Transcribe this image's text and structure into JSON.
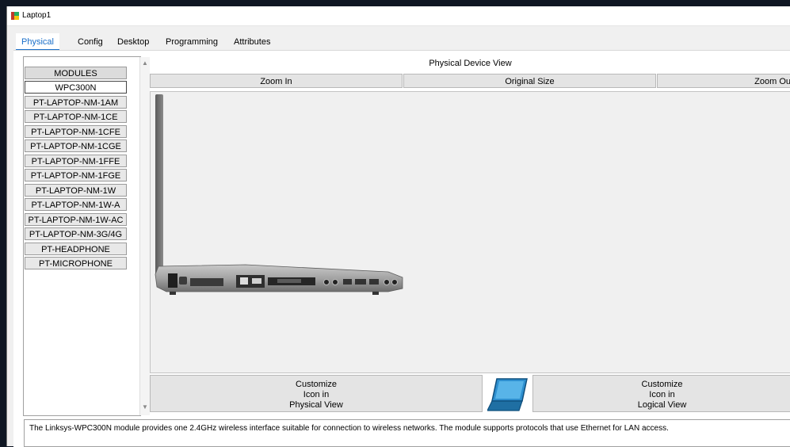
{
  "window": {
    "title": "Laptop1"
  },
  "tabs": [
    {
      "label": "Physical",
      "active": true
    },
    {
      "label": "Config"
    },
    {
      "label": "Desktop"
    },
    {
      "label": "Programming"
    },
    {
      "label": "Attributes"
    }
  ],
  "modules": {
    "header": "MODULES",
    "items": [
      "WPC300N",
      "PT-LAPTOP-NM-1AM",
      "PT-LAPTOP-NM-1CE",
      "PT-LAPTOP-NM-1CFE",
      "PT-LAPTOP-NM-1CGE",
      "PT-LAPTOP-NM-1FFE",
      "PT-LAPTOP-NM-1FGE",
      "PT-LAPTOP-NM-1W",
      "PT-LAPTOP-NM-1W-A",
      "PT-LAPTOP-NM-1W-AC",
      "PT-LAPTOP-NM-3G/4G",
      "PT-HEADPHONE",
      "PT-MICROPHONE"
    ],
    "selected": "WPC300N"
  },
  "physical_view": {
    "title": "Physical Device View",
    "zoom_in": "Zoom In",
    "original_size": "Original Size",
    "zoom_out": "Zoom Ou"
  },
  "customize": {
    "physical": [
      "Customize",
      "Icon in",
      "Physical View"
    ],
    "logical": [
      "Customize",
      "Icon in",
      "Logical View"
    ]
  },
  "description": "The Linksys-WPC300N module provides one 2.4GHz wireless interface suitable for connection to wireless networks. The module supports protocols that use Ethernet for LAN access.",
  "colors": {
    "accent": "#1a6fc9",
    "laptop_icon": "#2d8fcf"
  }
}
